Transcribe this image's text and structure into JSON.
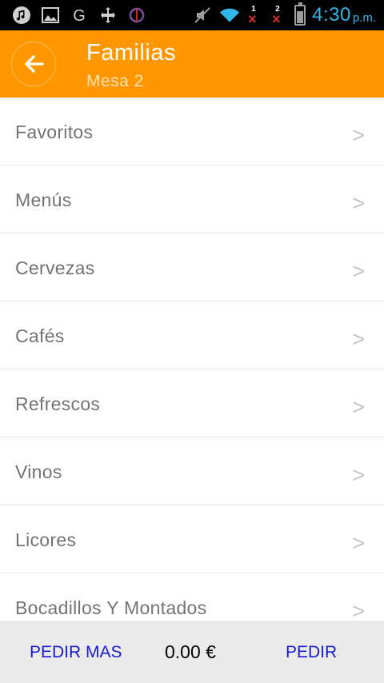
{
  "status_bar": {
    "icons": [
      "music-note-icon",
      "image-icon",
      "google-icon",
      "move-arrows-icon",
      "app-icon",
      "mute-icon",
      "wifi-icon"
    ],
    "sim1": "1",
    "sim2": "2",
    "time": "4:30",
    "ampm": "p.m.",
    "colors": {
      "background": "#000000",
      "time": "#33b5e5",
      "no_signal": "#d32f2f"
    }
  },
  "header": {
    "back_icon": "arrow-left-icon",
    "title": "Familias",
    "subtitle": "Mesa 2",
    "colors": {
      "background": "#ff9800"
    }
  },
  "list": {
    "chevron": ">",
    "items": [
      {
        "label": "Favoritos"
      },
      {
        "label": "Menús"
      },
      {
        "label": "Cervezas"
      },
      {
        "label": "Cafés"
      },
      {
        "label": "Refrescos"
      },
      {
        "label": "Vinos"
      },
      {
        "label": "Licores"
      },
      {
        "label": "Bocadillos Y Montados"
      }
    ]
  },
  "footer": {
    "more_label": "PEDIR MAS",
    "total": "0.00 €",
    "order_label": "PEDIR",
    "colors": {
      "background": "#ebebeb",
      "action": "#1a1ad6"
    }
  }
}
